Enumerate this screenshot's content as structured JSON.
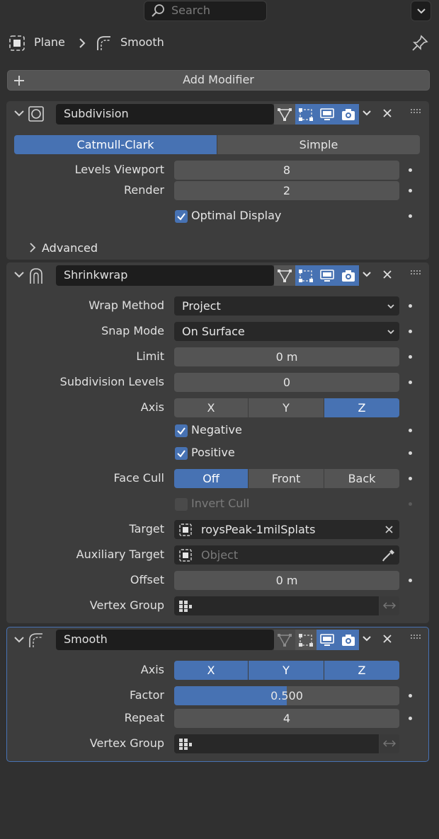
{
  "header": {
    "search_placeholder": "Search",
    "breadcrumb": {
      "object": "Plane",
      "modifier": "Smooth"
    }
  },
  "add_modifier_label": "Add Modifier",
  "subdivision": {
    "name": "Subdivision",
    "tabs": [
      "Catmull-Clark",
      "Simple"
    ],
    "levels_viewport_label": "Levels Viewport",
    "levels_viewport": "8",
    "render_label": "Render",
    "render": "2",
    "optimal_display_label": "Optimal Display",
    "advanced_label": "Advanced"
  },
  "shrinkwrap": {
    "name": "Shrinkwrap",
    "wrap_method_label": "Wrap Method",
    "wrap_method": "Project",
    "snap_mode_label": "Snap Mode",
    "snap_mode": "On Surface",
    "limit_label": "Limit",
    "limit": "0 m",
    "subdivision_levels_label": "Subdivision Levels",
    "subdivision_levels": "0",
    "axis_label": "Axis",
    "axes": [
      "X",
      "Y",
      "Z"
    ],
    "negative_label": "Negative",
    "positive_label": "Positive",
    "face_cull_label": "Face Cull",
    "face_cull": [
      "Off",
      "Front",
      "Back"
    ],
    "invert_cull_label": "Invert Cull",
    "target_label": "Target",
    "target": "roysPeak-1milSplats",
    "aux_target_label": "Auxiliary Target",
    "aux_target_placeholder": "Object",
    "offset_label": "Offset",
    "offset": "0 m",
    "vertex_group_label": "Vertex Group"
  },
  "smooth": {
    "name": "Smooth",
    "axis_label": "Axis",
    "axes": [
      "X",
      "Y",
      "Z"
    ],
    "factor_label": "Factor",
    "factor": "0.500",
    "factor_fraction": 0.5,
    "repeat_label": "Repeat",
    "repeat": "4",
    "vertex_group_label": "Vertex Group"
  },
  "colors": {
    "accent": "#4772b3",
    "panel": "#3d3d3d",
    "field": "#545454",
    "background": "#303030"
  }
}
